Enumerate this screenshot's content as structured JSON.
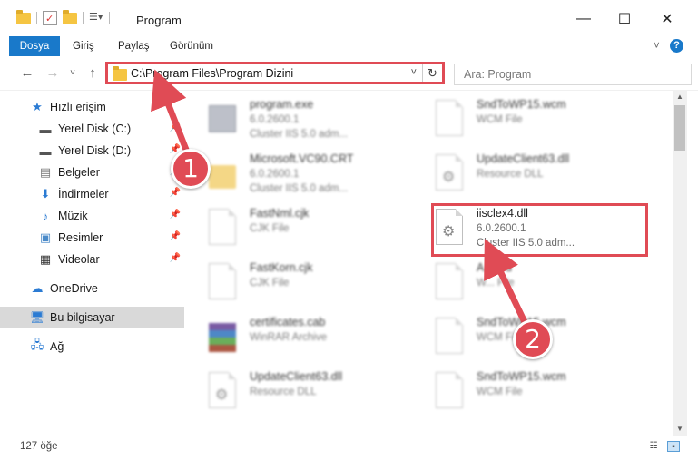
{
  "window": {
    "title": "Program",
    "minimize": "—",
    "maximize": "☐",
    "close": "✕"
  },
  "ribbon": {
    "tabs": [
      "Dosya",
      "Giriş",
      "Paylaş",
      "Görünüm"
    ],
    "expand": "˅",
    "help": "?"
  },
  "address": {
    "path": "C:\\Program Files\\Program Dizini",
    "dropdown": "˅",
    "refresh": "↻"
  },
  "search": {
    "placeholder": "Ara: Program"
  },
  "nav": {
    "back": "←",
    "forward": "→",
    "recent": "˅",
    "up": "↑"
  },
  "sidebar": {
    "items": [
      {
        "label": "Hızlı erişim",
        "icon": "star-icon"
      },
      {
        "label": "Yerel Disk (C:)",
        "icon": "drive-icon",
        "pinned": true
      },
      {
        "label": "Yerel Disk (D:)",
        "icon": "drive-icon",
        "pinned": true
      },
      {
        "label": "Belgeler",
        "icon": "documents-icon",
        "pinned": true
      },
      {
        "label": "İndirmeler",
        "icon": "download-icon",
        "pinned": true
      },
      {
        "label": "Müzik",
        "icon": "music-icon",
        "pinned": true
      },
      {
        "label": "Resimler",
        "icon": "pictures-icon",
        "pinned": true
      },
      {
        "label": "Videolar",
        "icon": "videos-icon",
        "pinned": true
      },
      {
        "label": "OneDrive",
        "icon": "cloud-icon"
      },
      {
        "label": "Bu bilgisayar",
        "icon": "computer-icon",
        "selected": true
      },
      {
        "label": "Ağ",
        "icon": "network-icon"
      }
    ]
  },
  "files": [
    {
      "name": "program.exe",
      "line2": "6.0.2600.1",
      "line3": "Cluster IIS 5.0 adm..."
    },
    {
      "name": "SndToWP15.wcm",
      "line2": "WCM File",
      "line3": ""
    },
    {
      "name": "Microsoft.VC90.CRT",
      "line2": "6.0.2600.1",
      "line3": "Cluster IIS 5.0 adm..."
    },
    {
      "name": "UpdateClient63.dll",
      "line2": "Resource DLL",
      "line3": ""
    },
    {
      "name": "FastNml.cjk",
      "line2": "CJK File",
      "line3": ""
    },
    {
      "name": "iisclex4.dll",
      "line2": "6.0.2600.1",
      "line3": "Cluster IIS 5.0 adm..."
    },
    {
      "name": "FastKorn.cjk",
      "line2": "CJK File",
      "line3": ""
    },
    {
      "name": "A...wrd",
      "line2": "W... File",
      "line3": ""
    },
    {
      "name": "certificates.cab",
      "line2": "WinRAR Archive",
      "line3": ""
    },
    {
      "name": "SndToWP15.wcm",
      "line2": "WCM File",
      "line3": ""
    },
    {
      "name": "UpdateClient63.dll",
      "line2": "Resource DLL",
      "line3": ""
    },
    {
      "name": "SndToWP15.wcm",
      "line2": "WCM File",
      "line3": ""
    }
  ],
  "status": {
    "count": "127 öğe"
  },
  "annotations": {
    "step1": "1",
    "step2": "2",
    "color": "#e04b55"
  }
}
